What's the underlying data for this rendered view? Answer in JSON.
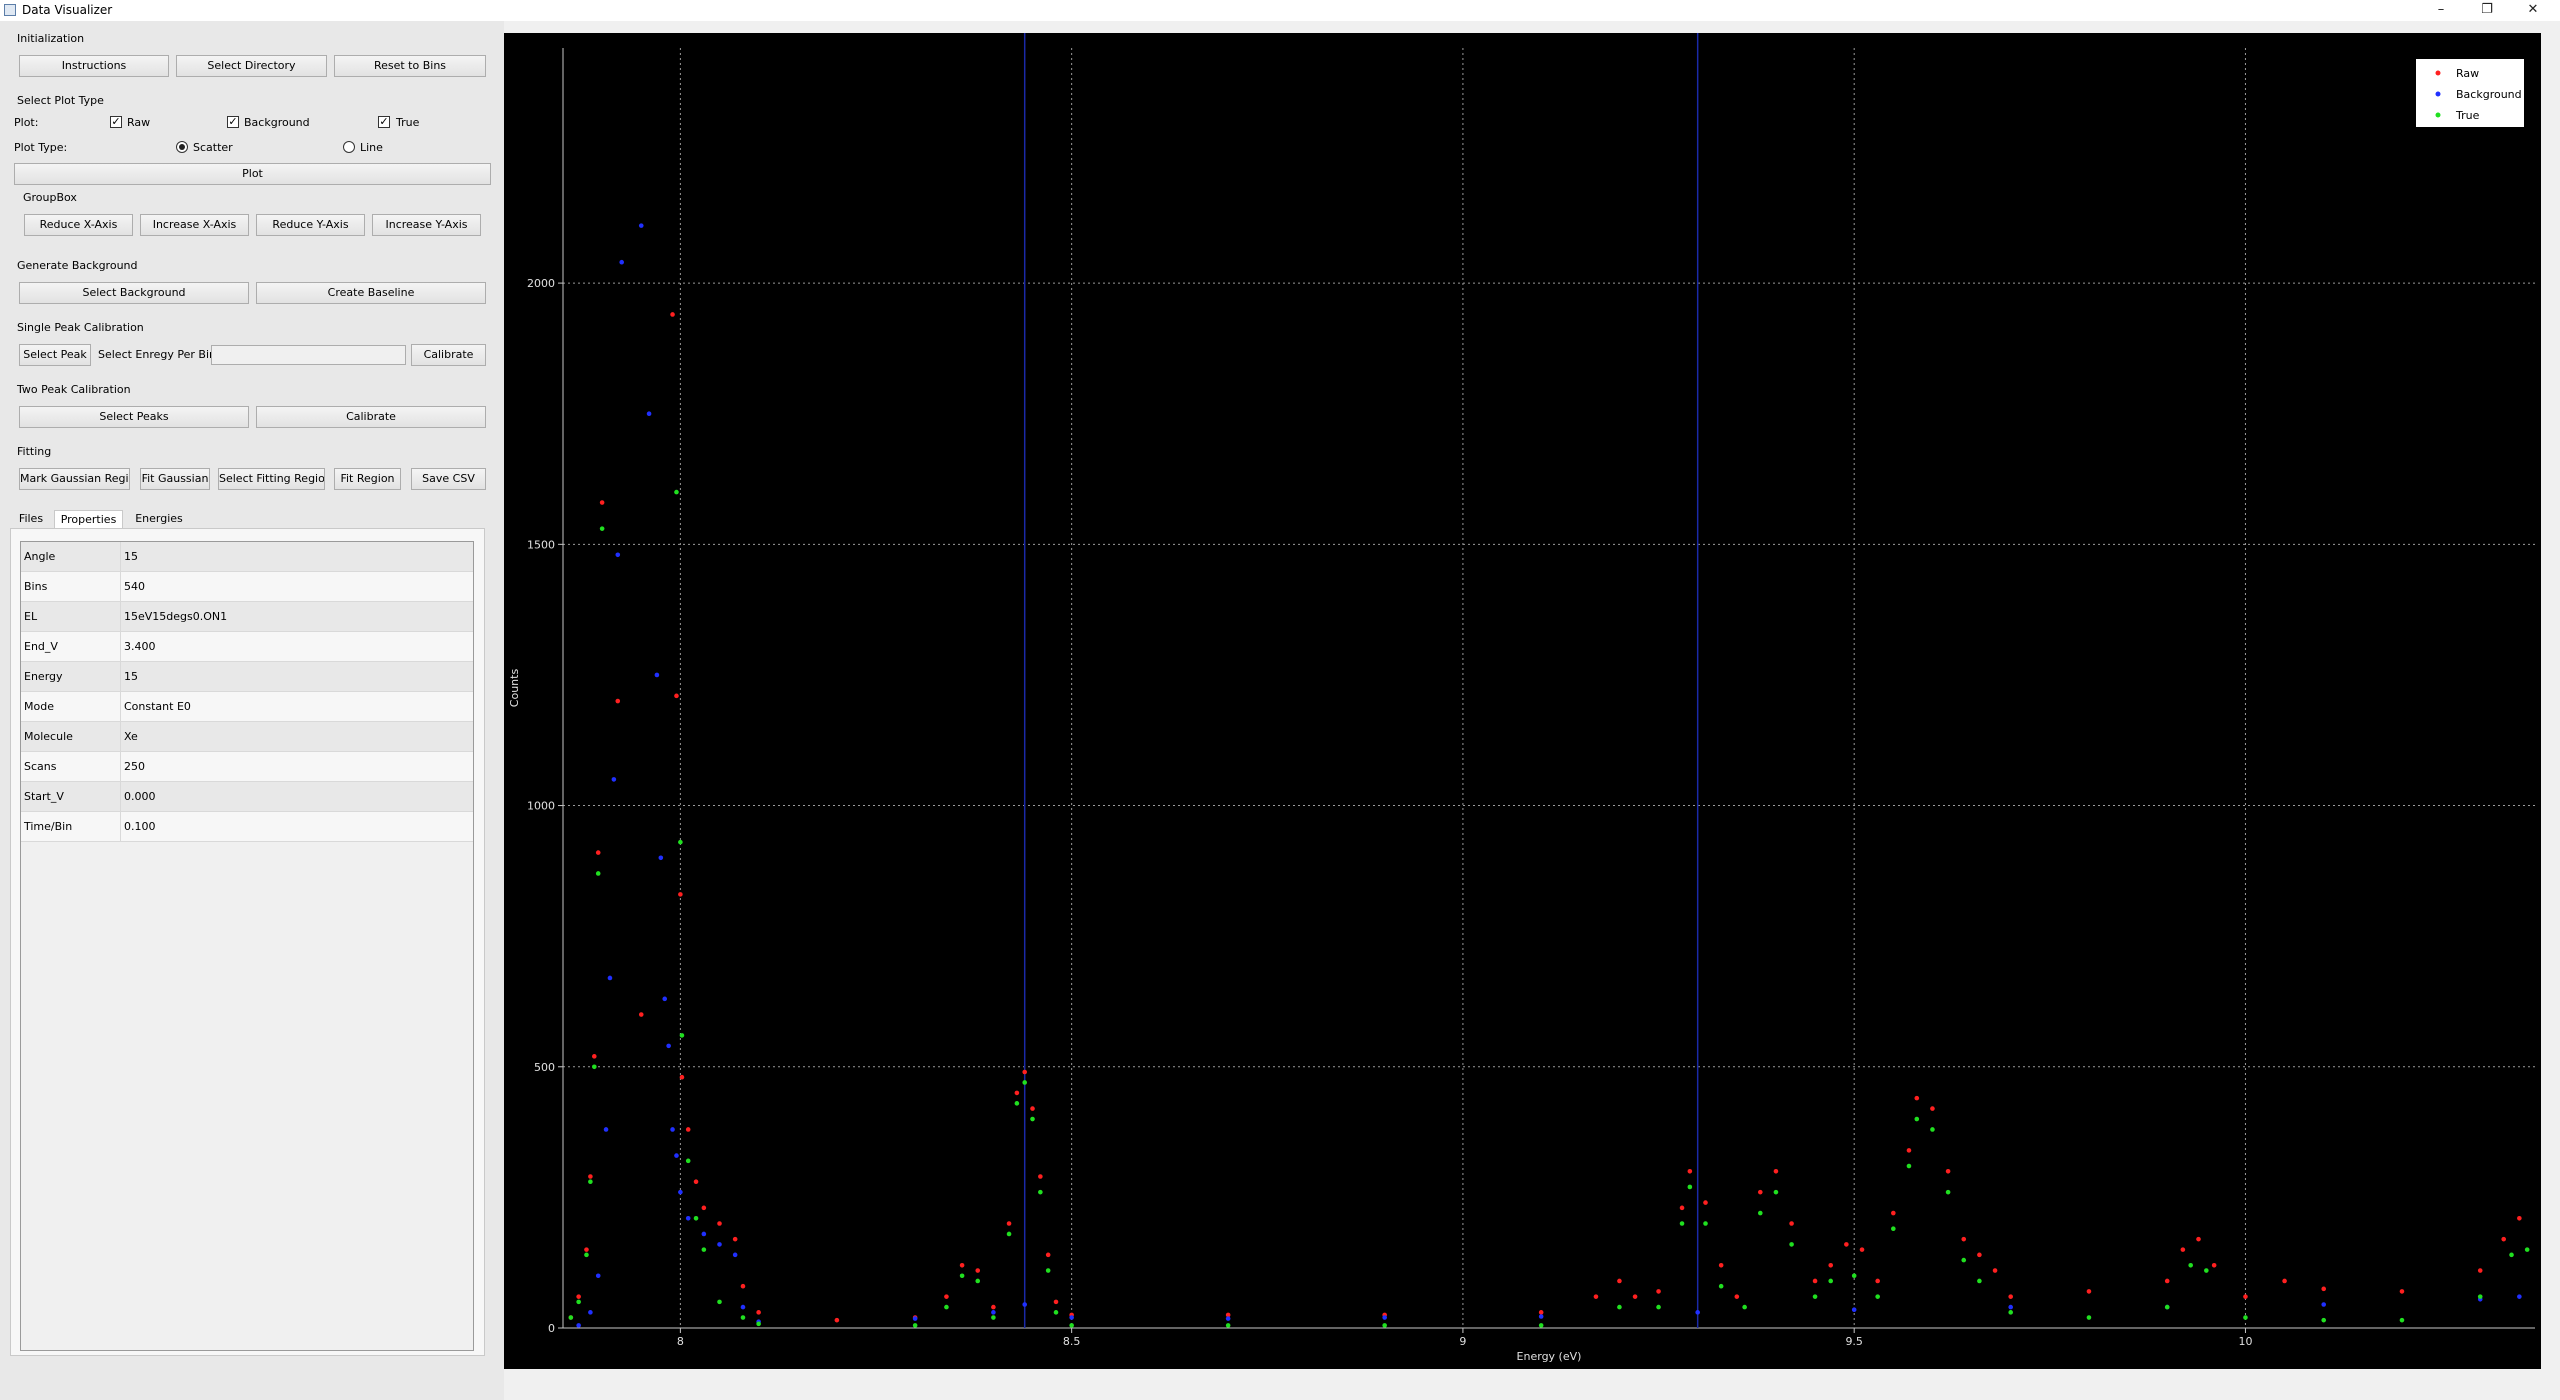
{
  "window": {
    "title": "Data Visualizer",
    "minimize": "–",
    "restore": "❐",
    "close": "✕"
  },
  "initialization": {
    "group": "Initialization",
    "instructions": "Instructions",
    "select_directory": "Select Directory",
    "reset_to_bins": "Reset to Bins"
  },
  "plot_type": {
    "group": "Select Plot Type",
    "plot_label": "Plot:",
    "raw": "Raw",
    "raw_checked": true,
    "background": "Background",
    "background_checked": true,
    "true_label": "True",
    "true_checked": true,
    "type_label": "Plot Type:",
    "scatter": "Scatter",
    "line": "Line",
    "selected": "Scatter",
    "plot_button": "Plot"
  },
  "groupbox": {
    "group": "GroupBox",
    "reduce_x": "Reduce X-Axis",
    "increase_x": "Increase X-Axis",
    "reduce_y": "Reduce Y-Axis",
    "increase_y": "Increase Y-Axis"
  },
  "background": {
    "group": "Generate Background",
    "select_background": "Select Background",
    "create_baseline": "Create Baseline"
  },
  "single_peak": {
    "group": "Single Peak Calibration",
    "select_peak": "Select Peak",
    "energy_label": "Select Enregy Per Bin:",
    "energy_value": "",
    "calibrate": "Calibrate"
  },
  "two_peak": {
    "group": "Two Peak Calibration",
    "select_peaks": "Select Peaks",
    "calibrate": "Calibrate"
  },
  "fitting": {
    "group": "Fitting",
    "mark_gaussian": "Mark Gaussian Region",
    "fit_gaussian": "Fit Gaussian",
    "select_fitting": "Select Fitting Region",
    "fit_region": "Fit Region",
    "save_csv": "Save CSV"
  },
  "tabs": [
    {
      "label": "Files"
    },
    {
      "label": "Properties"
    },
    {
      "label": "Energies"
    }
  ],
  "active_tab": "Properties",
  "properties": [
    {
      "key": "Angle",
      "value": "15"
    },
    {
      "key": "Bins",
      "value": "540"
    },
    {
      "key": "EL",
      "value": "15eV15degs0.ON1"
    },
    {
      "key": "End_V",
      "value": "3.400"
    },
    {
      "key": "Energy",
      "value": "15"
    },
    {
      "key": "Mode",
      "value": "Constant E0"
    },
    {
      "key": "Molecule",
      "value": "Xe"
    },
    {
      "key": "Scans",
      "value": "250"
    },
    {
      "key": "Start_V",
      "value": "0.000"
    },
    {
      "key": "Time/Bin",
      "value": "0.100"
    }
  ],
  "colors": {
    "raw": "#ff2020",
    "background": "#2030ff",
    "true": "#20e020",
    "marker_line": "#1a2aa8",
    "plot_bg": "#000000",
    "grid": "#9a9a9a"
  },
  "chart_data": {
    "type": "scatter",
    "xlabel": "Energy (eV)",
    "ylabel": "Counts",
    "xlim": [
      7.85,
      10.37
    ],
    "ylim": [
      0,
      2450
    ],
    "xticks": [
      8,
      8.5,
      9,
      9.5,
      10
    ],
    "yticks": [
      0,
      500,
      1000,
      1500,
      2000
    ],
    "grid": true,
    "legend_position": "top-right",
    "vertical_markers": [
      8.44,
      9.3
    ],
    "series": [
      {
        "name": "Raw",
        "color": "#ff2020",
        "points": [
          [
            7.86,
            20
          ],
          [
            7.87,
            60
          ],
          [
            7.88,
            150
          ],
          [
            7.885,
            290
          ],
          [
            7.89,
            520
          ],
          [
            7.895,
            910
          ],
          [
            7.9,
            1580
          ],
          [
            7.92,
            1200
          ],
          [
            7.95,
            600
          ],
          [
            7.99,
            1940
          ],
          [
            7.995,
            1210
          ],
          [
            8.0,
            830
          ],
          [
            8.002,
            480
          ],
          [
            8.01,
            380
          ],
          [
            8.02,
            280
          ],
          [
            8.03,
            230
          ],
          [
            8.05,
            200
          ],
          [
            8.07,
            170
          ],
          [
            8.08,
            80
          ],
          [
            8.1,
            30
          ],
          [
            8.2,
            15
          ],
          [
            8.3,
            20
          ],
          [
            8.34,
            60
          ],
          [
            8.36,
            120
          ],
          [
            8.38,
            110
          ],
          [
            8.4,
            40
          ],
          [
            8.42,
            200
          ],
          [
            8.43,
            450
          ],
          [
            8.44,
            490
          ],
          [
            8.45,
            420
          ],
          [
            8.46,
            290
          ],
          [
            8.47,
            140
          ],
          [
            8.48,
            50
          ],
          [
            8.5,
            25
          ],
          [
            8.7,
            25
          ],
          [
            8.9,
            25
          ],
          [
            9.1,
            30
          ],
          [
            9.17,
            60
          ],
          [
            9.2,
            90
          ],
          [
            9.22,
            60
          ],
          [
            9.25,
            70
          ],
          [
            9.28,
            230
          ],
          [
            9.29,
            300
          ],
          [
            9.31,
            240
          ],
          [
            9.33,
            120
          ],
          [
            9.35,
            60
          ],
          [
            9.38,
            260
          ],
          [
            9.4,
            300
          ],
          [
            9.42,
            200
          ],
          [
            9.45,
            90
          ],
          [
            9.47,
            120
          ],
          [
            9.49,
            160
          ],
          [
            9.51,
            150
          ],
          [
            9.53,
            90
          ],
          [
            9.55,
            220
          ],
          [
            9.57,
            340
          ],
          [
            9.58,
            440
          ],
          [
            9.6,
            420
          ],
          [
            9.62,
            300
          ],
          [
            9.64,
            170
          ],
          [
            9.66,
            140
          ],
          [
            9.68,
            110
          ],
          [
            9.7,
            60
          ],
          [
            9.8,
            70
          ],
          [
            9.9,
            90
          ],
          [
            9.92,
            150
          ],
          [
            9.94,
            170
          ],
          [
            9.96,
            120
          ],
          [
            10.0,
            60
          ],
          [
            10.05,
            90
          ],
          [
            10.1,
            75
          ],
          [
            10.2,
            70
          ],
          [
            10.3,
            110
          ],
          [
            10.33,
            170
          ],
          [
            10.35,
            210
          ]
        ]
      },
      {
        "name": "Background",
        "color": "#2030ff",
        "points": [
          [
            7.87,
            5
          ],
          [
            7.885,
            30
          ],
          [
            7.895,
            100
          ],
          [
            7.905,
            380
          ],
          [
            7.91,
            670
          ],
          [
            7.915,
            1050
          ],
          [
            7.92,
            1480
          ],
          [
            7.925,
            2040
          ],
          [
            7.95,
            2110
          ],
          [
            7.96,
            1750
          ],
          [
            7.97,
            1250
          ],
          [
            7.975,
            900
          ],
          [
            7.98,
            630
          ],
          [
            7.985,
            540
          ],
          [
            7.99,
            380
          ],
          [
            7.995,
            330
          ],
          [
            8.0,
            260
          ],
          [
            8.01,
            210
          ],
          [
            8.03,
            180
          ],
          [
            8.05,
            160
          ],
          [
            8.07,
            140
          ],
          [
            8.08,
            40
          ],
          [
            8.1,
            12
          ],
          [
            8.3,
            18
          ],
          [
            8.4,
            30
          ],
          [
            8.44,
            45
          ],
          [
            8.5,
            20
          ],
          [
            8.7,
            18
          ],
          [
            8.9,
            20
          ],
          [
            9.1,
            22
          ],
          [
            9.3,
            30
          ],
          [
            9.5,
            35
          ],
          [
            9.7,
            40
          ],
          [
            9.9,
            40
          ],
          [
            10.1,
            45
          ],
          [
            10.3,
            55
          ],
          [
            10.35,
            60
          ]
        ]
      },
      {
        "name": "True",
        "color": "#20e020",
        "points": [
          [
            7.86,
            20
          ],
          [
            7.87,
            50
          ],
          [
            7.88,
            140
          ],
          [
            7.885,
            280
          ],
          [
            7.89,
            500
          ],
          [
            7.895,
            870
          ],
          [
            7.9,
            1530
          ],
          [
            7.995,
            1600
          ],
          [
            8.0,
            930
          ],
          [
            8.002,
            560
          ],
          [
            8.01,
            320
          ],
          [
            8.02,
            210
          ],
          [
            8.03,
            150
          ],
          [
            8.05,
            50
          ],
          [
            8.08,
            20
          ],
          [
            8.1,
            8
          ],
          [
            8.3,
            5
          ],
          [
            8.34,
            40
          ],
          [
            8.36,
            100
          ],
          [
            8.38,
            90
          ],
          [
            8.4,
            20
          ],
          [
            8.42,
            180
          ],
          [
            8.43,
            430
          ],
          [
            8.44,
            470
          ],
          [
            8.45,
            400
          ],
          [
            8.46,
            260
          ],
          [
            8.47,
            110
          ],
          [
            8.48,
            30
          ],
          [
            8.5,
            5
          ],
          [
            8.7,
            5
          ],
          [
            8.9,
            5
          ],
          [
            9.1,
            5
          ],
          [
            9.2,
            40
          ],
          [
            9.25,
            40
          ],
          [
            9.28,
            200
          ],
          [
            9.29,
            270
          ],
          [
            9.31,
            200
          ],
          [
            9.33,
            80
          ],
          [
            9.36,
            40
          ],
          [
            9.38,
            220
          ],
          [
            9.4,
            260
          ],
          [
            9.42,
            160
          ],
          [
            9.45,
            60
          ],
          [
            9.47,
            90
          ],
          [
            9.5,
            100
          ],
          [
            9.53,
            60
          ],
          [
            9.55,
            190
          ],
          [
            9.57,
            310
          ],
          [
            9.58,
            400
          ],
          [
            9.6,
            380
          ],
          [
            9.62,
            260
          ],
          [
            9.64,
            130
          ],
          [
            9.66,
            90
          ],
          [
            9.7,
            30
          ],
          [
            9.8,
            20
          ],
          [
            9.9,
            40
          ],
          [
            9.93,
            120
          ],
          [
            9.95,
            110
          ],
          [
            10.0,
            20
          ],
          [
            10.1,
            15
          ],
          [
            10.2,
            15
          ],
          [
            10.3,
            60
          ],
          [
            10.34,
            140
          ],
          [
            10.36,
            150
          ]
        ]
      }
    ]
  }
}
